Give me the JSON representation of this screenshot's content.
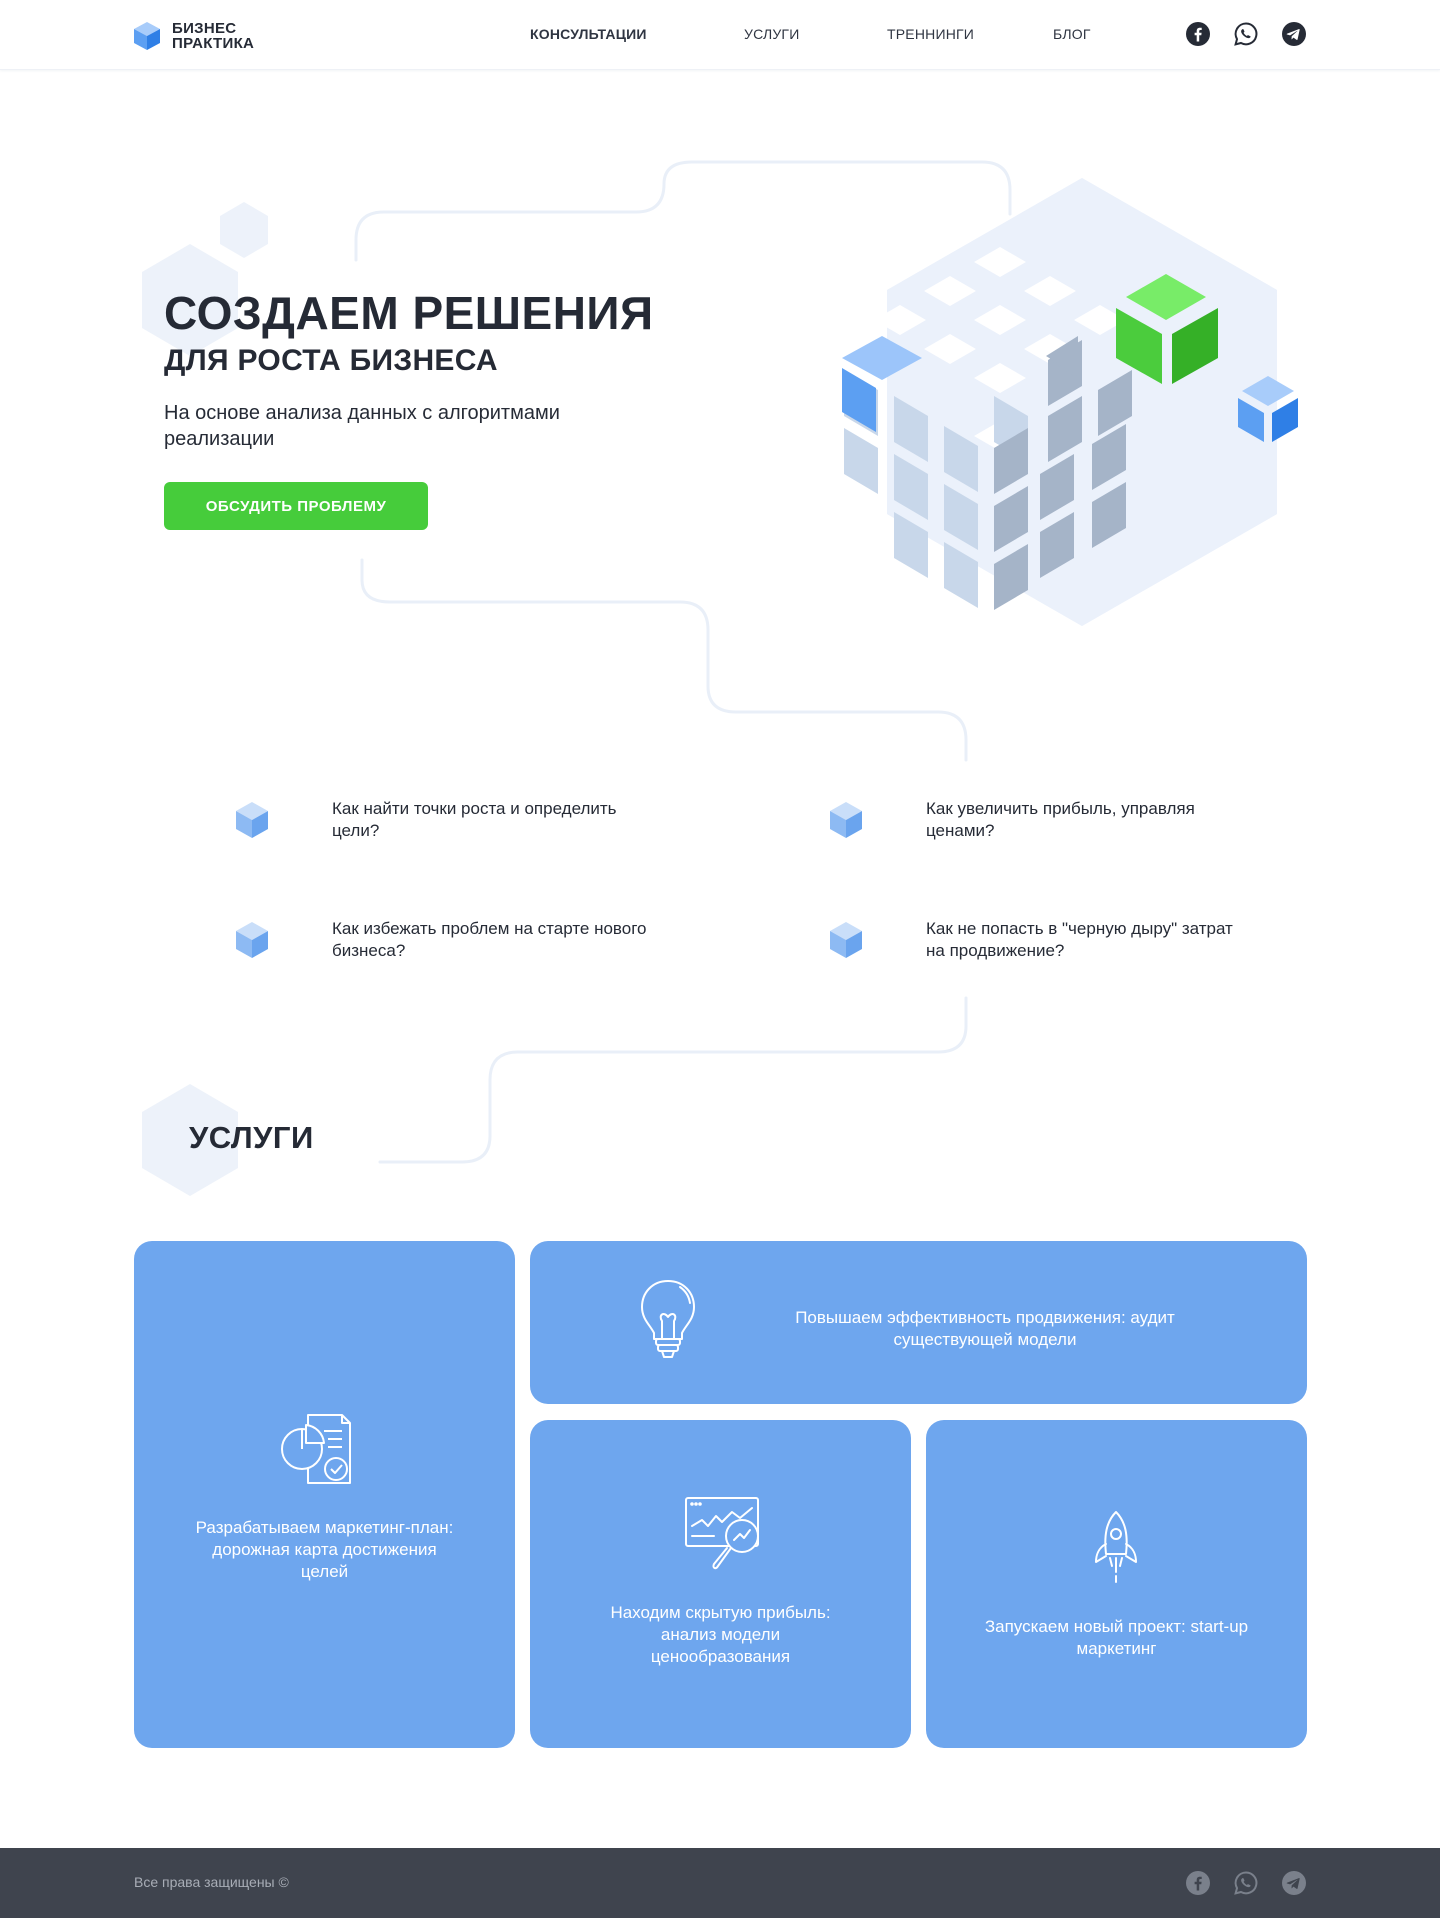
{
  "header": {
    "logo_line1": "БИЗНЕС",
    "logo_line2": "ПРАКТИКА",
    "nav": [
      {
        "label": "КОНСУЛЬТАЦИИ"
      },
      {
        "label": "УСЛУГИ"
      },
      {
        "label": "ТРЕННИНГИ"
      },
      {
        "label": "БЛОГ"
      }
    ],
    "socials": [
      "facebook-icon",
      "whatsapp-icon",
      "telegram-icon"
    ]
  },
  "hero": {
    "title": "СОЗДАЕМ РЕШЕНИЯ",
    "subtitle": "ДЛЯ РОСТА БИЗНЕСА",
    "text": "На основе анализа данных с алгоритмами реализации",
    "cta_label": "ОБСУДИТЬ ПРОБЛЕМУ"
  },
  "questions": [
    {
      "text": "Как найти точки роста и определить цели?"
    },
    {
      "text": "Как увеличить прибыль, управляя ценами?"
    },
    {
      "text": "Как избежать проблем на старте нового бизнеса?"
    },
    {
      "text": "Как не попасть в \"черную дыру\" затрат на продвижение?"
    }
  ],
  "services": {
    "title": "УСЛУГИ",
    "cards": [
      {
        "text": "Разрабатываем маркетинг-план: дорожная карта достижения целей",
        "icon": "report-chart-icon"
      },
      {
        "text": "Повышаем эффективность продвижения: аудит существующей модели",
        "icon": "lightbulb-icon"
      },
      {
        "text": "Находим скрытую прибыль: анализ модели ценообразования",
        "icon": "chart-magnifier-icon"
      },
      {
        "text": "Запускаем новый проект: start-up маркетинг",
        "icon": "rocket-icon"
      }
    ]
  },
  "footer": {
    "copyright": "Все права защищены ©"
  },
  "colors": {
    "accent_green": "#46cc3b",
    "card_blue": "#6ea6ee",
    "footer_bg": "#3f444e",
    "text_dark": "#252a35"
  }
}
